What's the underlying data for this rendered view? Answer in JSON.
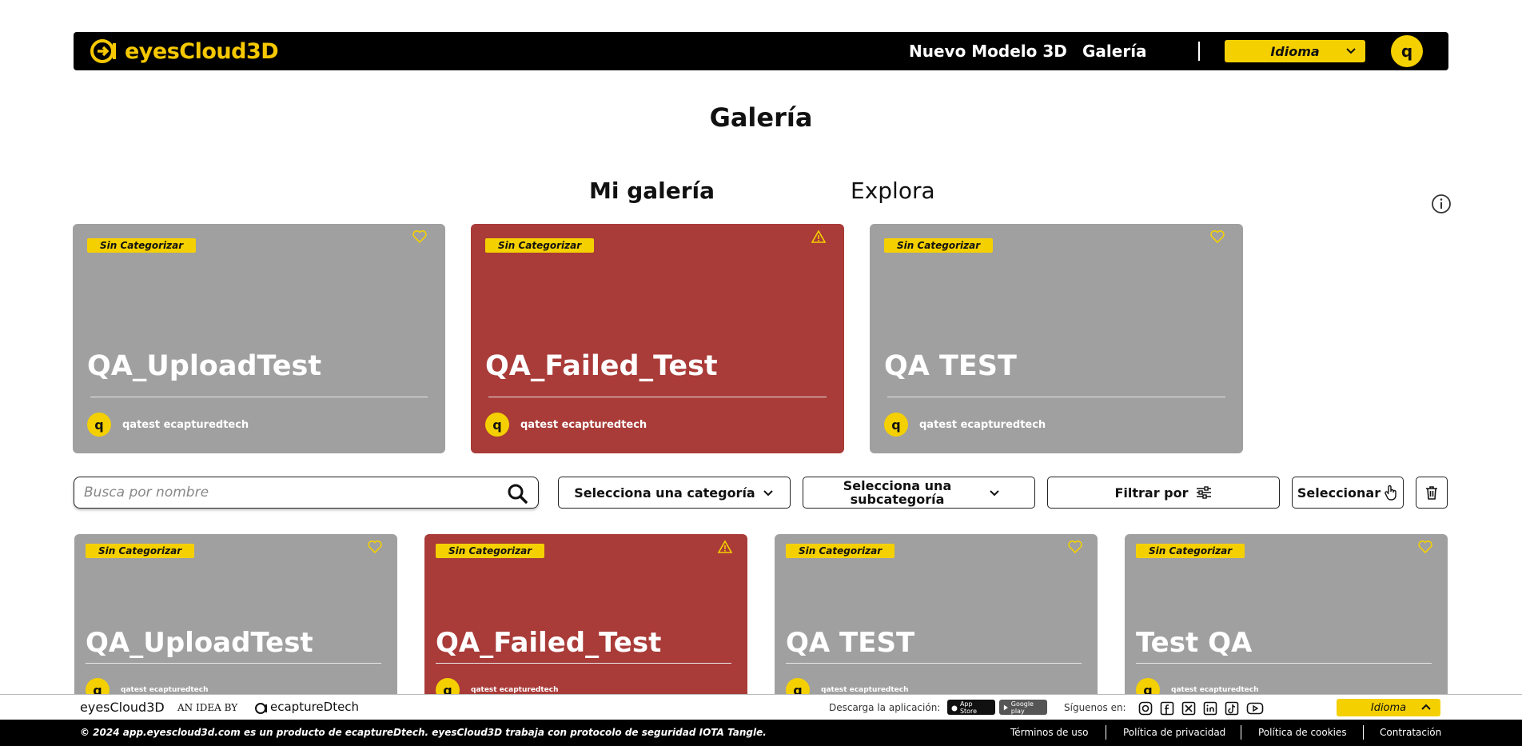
{
  "header": {
    "logo_text": "eyesCloud3D",
    "nav": {
      "new_model": "Nuevo Modelo 3D",
      "gallery": "Galería"
    },
    "language": "Idioma",
    "avatar_initial": "q"
  },
  "page": {
    "title": "Galería"
  },
  "tabs": {
    "mine": "Mi galería",
    "explore": "Explora"
  },
  "featured_cards": [
    {
      "badge": "Sin Categorizar",
      "title": "QA_UploadTest",
      "author": "qatest ecapturedtech",
      "avatar": "q",
      "status": "normal",
      "icon": "heart-icon"
    },
    {
      "badge": "Sin Categorizar",
      "title": "QA_Failed_Test",
      "author": "qatest ecapturedtech",
      "avatar": "q",
      "status": "failed",
      "icon": "warning-icon"
    },
    {
      "badge": "Sin Categorizar",
      "title": "QA TEST",
      "author": "qatest ecapturedtech",
      "avatar": "q",
      "status": "normal",
      "icon": "heart-icon"
    }
  ],
  "filters": {
    "search_placeholder": "Busca por nombre",
    "category": "Selecciona una categoría",
    "subcategory": "Selecciona una subcategoría",
    "filter_by": "Filtrar por",
    "select": "Seleccionar"
  },
  "grid_cards": [
    {
      "badge": "Sin Categorizar",
      "title": "QA_UploadTest",
      "author": "qatest ecapturedtech",
      "avatar": "q",
      "status": "normal",
      "icon": "heart-icon"
    },
    {
      "badge": "Sin Categorizar",
      "title": "QA_Failed_Test",
      "author": "qatest ecapturedtech",
      "avatar": "q",
      "status": "failed",
      "icon": "warning-icon"
    },
    {
      "badge": "Sin Categorizar",
      "title": "QA TEST",
      "author": "qatest ecapturedtech",
      "avatar": "q",
      "status": "normal",
      "icon": "heart-icon"
    },
    {
      "badge": "Sin Categorizar",
      "title": "Test QA",
      "author": "qatest ecapturedtech",
      "avatar": "q",
      "status": "normal",
      "icon": "heart-icon"
    }
  ],
  "footer": {
    "brand": "eyesCloud3D",
    "idea_by": "AN IDEA BY",
    "company": "ecaptureDtech",
    "download_label": "Descarga la aplicación:",
    "app_store": "App Store",
    "google_play": "Google play",
    "follow_label": "Síguenos en:",
    "social": [
      "instagram-icon",
      "facebook-icon",
      "x-icon",
      "linkedin-icon",
      "tiktok-icon",
      "youtube-icon"
    ],
    "language": "Idioma",
    "copyright": "© 2024 app.eyescloud3d.com es un producto de ecaptureDtech. eyesCloud3D trabaja con protocolo de seguridad IOTA Tangle.",
    "links": {
      "terms": "Términos de uso",
      "privacy": "Política de privacidad",
      "cookies": "Política de cookies",
      "contract": "Contratación"
    }
  },
  "colors": {
    "accent": "#f5d000",
    "card_gray": "#a0a0a0",
    "card_failed": "#a93b38",
    "header_bg": "#000000"
  }
}
